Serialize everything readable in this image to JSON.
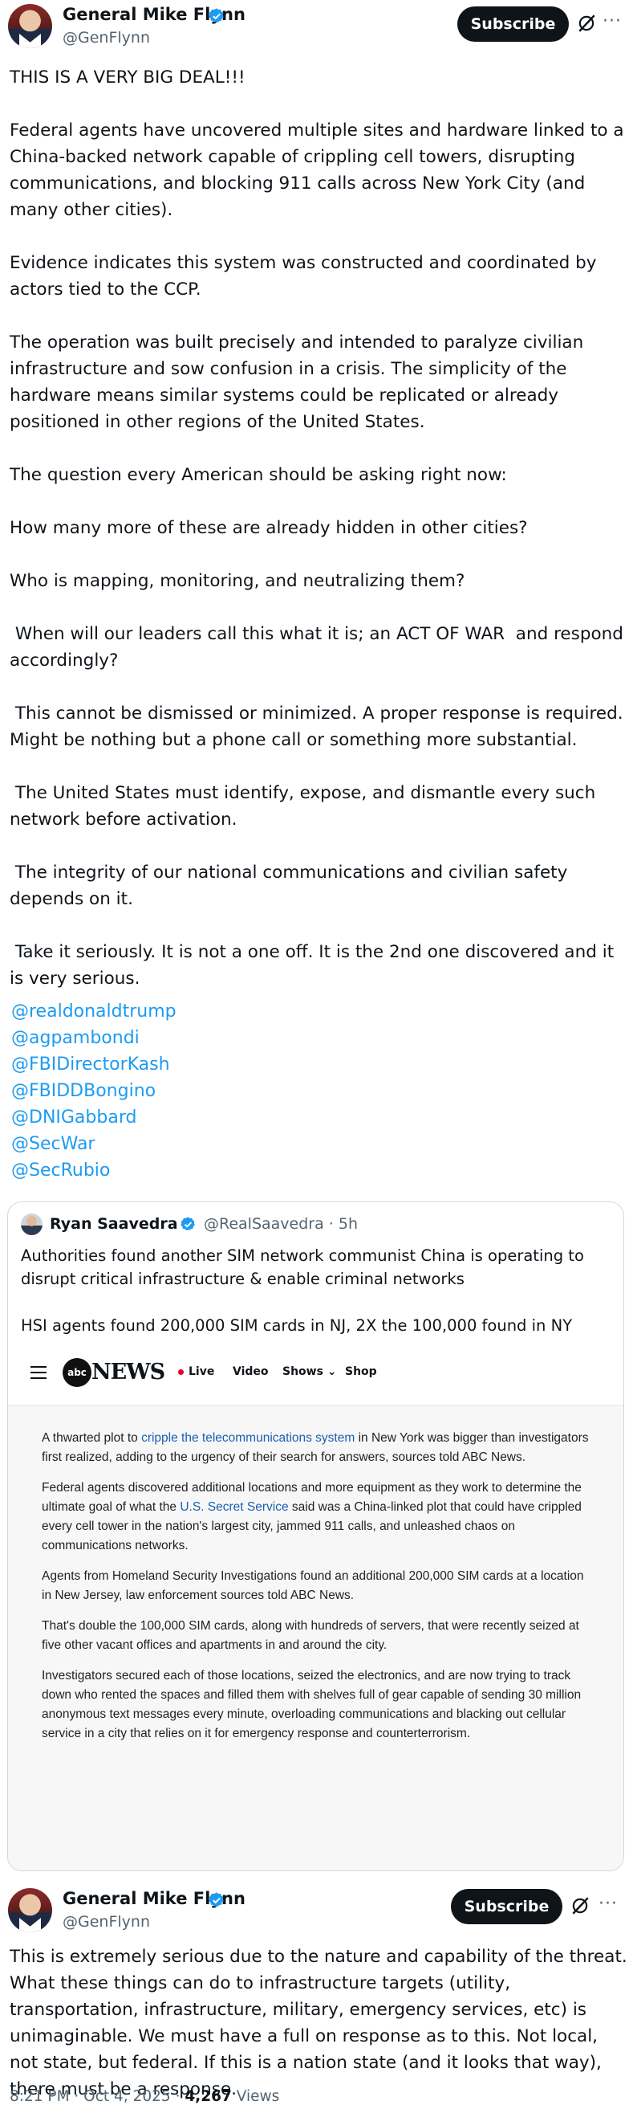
{
  "tweet": {
    "author_name": "General Mike Flynn",
    "author_handle": "@GenFlynn",
    "subscribe_label": "Subscribe",
    "more_label": "···",
    "paragraphs": [
      "THIS IS A VERY BIG DEAL!!!",
      "Federal agents have uncovered multiple sites and hardware linked to a China-backed network capable of crippling cell towers, disrupting communications, and blocking 911 calls across New York City (and many other cities).",
      "Evidence indicates this system was constructed and coordinated by actors tied to the CCP.",
      "The operation was built precisely and intended to paralyze civilian infrastructure and sow confusion in a crisis. The simplicity of the hardware means similar systems could be replicated or already positioned in other regions of the United States.",
      "The question every American should be asking right now:",
      "How many more of these are already hidden in other cities?",
      "Who is mapping, monitoring, and neutralizing them?",
      " When will our leaders call this what it is; an ACT OF WAR  and respond accordingly?",
      " This cannot be dismissed or minimized. A proper response is required. Might be nothing but a phone call or something more substantial.",
      " The United States must identify, expose, and dismantle every such network before activation.",
      " The integrity of our national communications and civilian safety depends on it.",
      " Take it seriously. It is not a one off. It is the 2nd one discovered and it is very serious."
    ],
    "mentions": [
      "@realdonaldtrump",
      "@agpambondi",
      "@FBIDirectorKash",
      "@FBIDDBongino",
      "@DNIGabbard",
      "@SecWar",
      "@SecRubio"
    ]
  },
  "quote": {
    "author_name": "Ryan Saavedra",
    "author_handle": "@RealSaavedra · 5h",
    "paragraphs": [
      "Authorities found another SIM network communist China is operating to disrupt critical infrastructure & enable criminal networks",
      "HSI agents found 200,000 SIM cards in NJ, 2X the 100,000 found in NY",
      "..."
    ],
    "image": {
      "logo_text": "abc",
      "brand": "NEWS",
      "nav": [
        "Live",
        "Video",
        "Shows ⌄",
        "Shop"
      ],
      "article": [
        {
          "before": "A thwarted plot to ",
          "link": "cripple the telecommunications system",
          "after": " in New York was bigger than investigators first realized, adding to the urgency of their search for answers, sources told ABC News."
        },
        {
          "before": "Federal agents discovered additional locations and more equipment as they work to determine the ultimate goal of what the ",
          "link": "U.S. Secret Service",
          "after": " said was a China-linked plot that could have crippled every cell tower in the nation's largest city, jammed 911 calls, and unleashed chaos on communications networks."
        },
        {
          "before": "Agents from Homeland Security Investigations found an additional 200,000 SIM cards at a location in New Jersey, law enforcement sources told ABC News.",
          "link": "",
          "after": ""
        },
        {
          "before": "That's double the 100,000 SIM cards, along with hundreds of servers, that were recently seized at five other vacant offices and apartments in and around the city.",
          "link": "",
          "after": ""
        },
        {
          "before": "Investigators secured each of those locations, seized the electronics, and are now trying to track down who rented the spaces and filled them with shelves full of gear capable of sending 30 million anonymous text messages every minute, overloading communications and blacking out cellular service in a city that relies on it for emergency response and counterterrorism.",
          "link": "",
          "after": ""
        }
      ]
    }
  },
  "reply": {
    "author_name": "General Mike Flynn",
    "author_handle": "@GenFlynn",
    "subscribe_label": "Subscribe",
    "more_label": "···",
    "text": "This is extremely serious due to the nature and capability of the threat. What these things can do to infrastructure targets (utility, transportation, infrastructure, military, emergency services, etc) is unimaginable. We must have a full on response as to this. Not local, not state, but federal. If this is a nation state (and it looks that way), there must be a response.",
    "timestamp": "8:21 PM · Oct 4, 2025 · ",
    "views_count": "4,267",
    "views_label": " Views"
  },
  "colors": {
    "accent": "#1d9bf0",
    "text": "#0f1419",
    "muted": "#536471",
    "verified": "#1d9bf0"
  }
}
